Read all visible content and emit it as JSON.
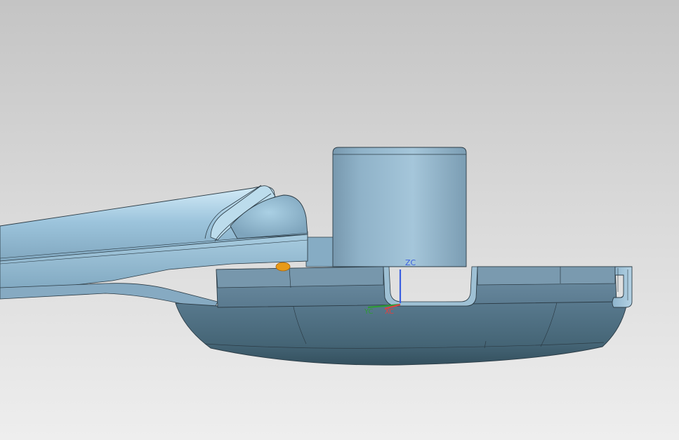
{
  "viewport": {
    "background_top": "#c4c4c4",
    "background_bottom": "#eeeeee"
  },
  "model": {
    "body_color": "#94b8d0",
    "shade_color": "#5c7d92",
    "edge_color": "#2c3c46",
    "origin_marker_color": "#e89a18"
  },
  "triad": {
    "z_label": "ZC",
    "y_label": "YC",
    "x_label": "XC",
    "z_color": "#3a5fe0",
    "y_color": "#2e9a36",
    "x_color": "#e04040"
  }
}
